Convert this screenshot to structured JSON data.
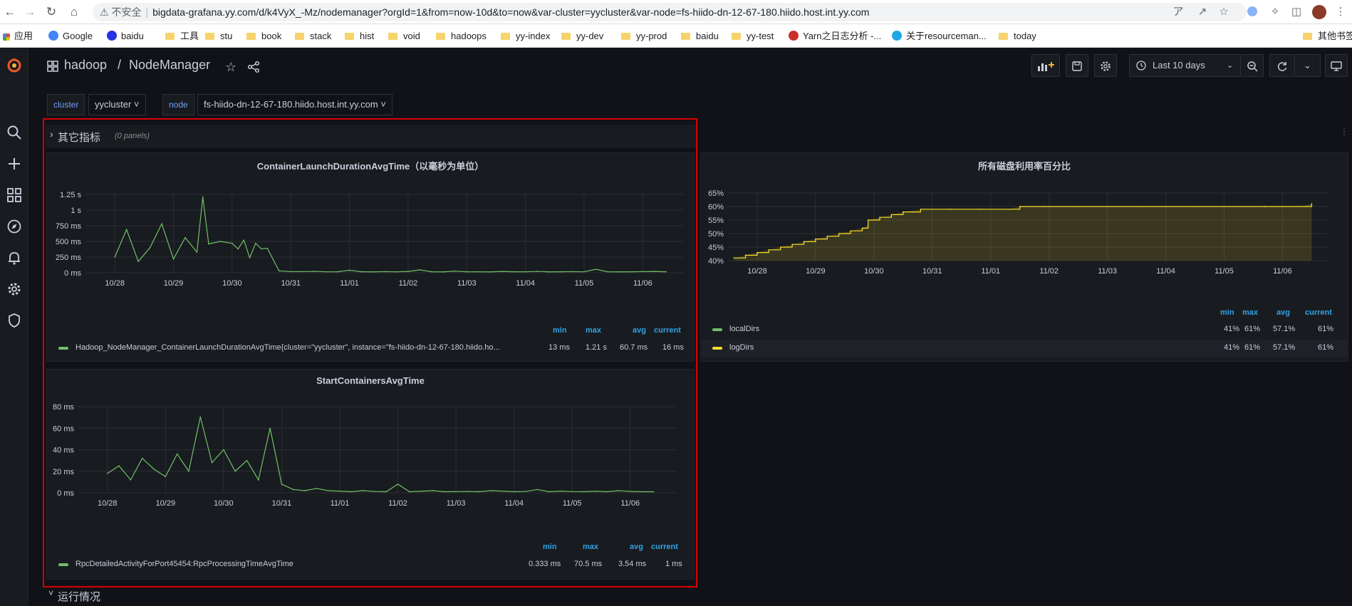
{
  "browser": {
    "insecure_label": "不安全",
    "url": "bigdata-grafana.yy.com/d/k4VyX_-Mz/nodemanager?orgId=1&from=now-10d&to=now&var-cluster=yycluster&var-node=fs-hiido-dn-12-67-180.hiido.host.int.yy.com",
    "bookmarks": [
      {
        "label": "应用",
        "kind": "apps"
      },
      {
        "label": "Google",
        "kind": "google"
      },
      {
        "label": "baidu",
        "kind": "baidu"
      },
      {
        "label": "工具",
        "kind": "folder"
      },
      {
        "label": "stu",
        "kind": "folder"
      },
      {
        "label": "book",
        "kind": "folder"
      },
      {
        "label": "stack",
        "kind": "folder"
      },
      {
        "label": "hist",
        "kind": "folder"
      },
      {
        "label": "void",
        "kind": "folder"
      },
      {
        "label": "hadoops",
        "kind": "folder"
      },
      {
        "label": "yy-index",
        "kind": "folder"
      },
      {
        "label": "yy-dev",
        "kind": "folder"
      },
      {
        "label": "yy-prod",
        "kind": "folder"
      },
      {
        "label": "baidu",
        "kind": "folder"
      },
      {
        "label": "yy-test",
        "kind": "folder"
      },
      {
        "label": "Yarn之日志分析 -...",
        "kind": "site-red"
      },
      {
        "label": "关于resourceman...",
        "kind": "site-blue"
      },
      {
        "label": "today",
        "kind": "folder"
      }
    ],
    "other_bookmarks": "其他书签"
  },
  "dashboard": {
    "folder": "hadoop",
    "separator": "/",
    "title": "NodeManager",
    "time_range": "Last 10 days",
    "variables": [
      {
        "label": "cluster",
        "value": "yycluster"
      },
      {
        "label": "node",
        "value": "fs-hiido-dn-12-67-180.hiido.host.int.yy.com"
      }
    ],
    "rows": [
      {
        "title": "其它指标",
        "subtitle": "(0 panels)"
      },
      {
        "title": "运行情况"
      }
    ]
  },
  "legend_headers": {
    "min": "min",
    "max": "max",
    "avg": "avg",
    "current": "current"
  },
  "colors": {
    "green": "#73bf69",
    "yellow": "#fade2a",
    "accent": "#33a2e5",
    "logo": "#f05a28"
  },
  "chart_data": [
    {
      "type": "line",
      "title": "ContainerLaunchDurationAvgTime（以毫秒为单位）",
      "x_ticks": [
        "10/28",
        "10/29",
        "10/30",
        "10/31",
        "11/01",
        "11/02",
        "11/03",
        "11/04",
        "11/05",
        "11/06"
      ],
      "y_ticks": [
        "1.25 s",
        "1 s",
        "750 ms",
        "500 ms",
        "250 ms",
        "0 ms"
      ],
      "ylim": [
        0,
        1250
      ],
      "unit": "ms",
      "series": [
        {
          "name": "Hadoop_NodeManager_ContainerLaunchDurationAvgTime{cluster=\"yycluster\", instance=\"fs-hiido-dn-12-67-180.hiido.ho...",
          "color": "#73bf69",
          "min": "13 ms",
          "max": "1.21 s",
          "avg": "60.7 ms",
          "current": "16 ms",
          "x": [
            0.0,
            0.2,
            0.4,
            0.6,
            0.8,
            1.0,
            1.2,
            1.4,
            1.5,
            1.6,
            1.8,
            2.0,
            2.1,
            2.2,
            2.3,
            2.4,
            2.5,
            2.6,
            2.7,
            2.8,
            3.0,
            3.2,
            3.4,
            3.6,
            3.8,
            4.0,
            4.2,
            4.4,
            4.6,
            4.8,
            5.0,
            5.2,
            5.4,
            5.6,
            5.8,
            6.0,
            6.2,
            6.4,
            6.6,
            6.8,
            7.0,
            7.2,
            7.4,
            7.6,
            7.8,
            8.0,
            8.2,
            8.4,
            8.6,
            8.8,
            9.0,
            9.2,
            9.4
          ],
          "values": [
            250,
            690,
            180,
            400,
            780,
            220,
            560,
            330,
            1210,
            460,
            500,
            470,
            380,
            520,
            240,
            470,
            380,
            390,
            210,
            30,
            18,
            18,
            22,
            15,
            16,
            40,
            16,
            14,
            18,
            15,
            20,
            45,
            16,
            14,
            25,
            16,
            15,
            14,
            20,
            16,
            15,
            22,
            14,
            16,
            18,
            15,
            55,
            16,
            14,
            15,
            18,
            20,
            16
          ]
        }
      ]
    },
    {
      "type": "line",
      "title": "StartContainersAvgTime",
      "x_ticks": [
        "10/28",
        "10/29",
        "10/30",
        "10/31",
        "11/01",
        "11/02",
        "11/03",
        "11/04",
        "11/05",
        "11/06"
      ],
      "y_ticks": [
        "80 ms",
        "60 ms",
        "40 ms",
        "20 ms",
        "0 ms"
      ],
      "ylim": [
        0,
        80
      ],
      "unit": "ms",
      "series": [
        {
          "name": "RpcDetailedActivityForPort45454:RpcProcessingTimeAvgTime",
          "color": "#73bf69",
          "min": "0.333 ms",
          "max": "70.5 ms",
          "avg": "3.54 ms",
          "current": "1 ms",
          "x": [
            0.0,
            0.2,
            0.4,
            0.6,
            0.8,
            1.0,
            1.2,
            1.4,
            1.6,
            1.8,
            2.0,
            2.2,
            2.4,
            2.6,
            2.8,
            3.0,
            3.2,
            3.4,
            3.6,
            3.8,
            4.0,
            4.2,
            4.4,
            4.6,
            4.8,
            5.0,
            5.2,
            5.4,
            5.6,
            5.8,
            6.0,
            6.2,
            6.4,
            6.6,
            6.8,
            7.0,
            7.2,
            7.4,
            7.6,
            7.8,
            8.0,
            8.2,
            8.4,
            8.6,
            8.8,
            9.0,
            9.2,
            9.4
          ],
          "values": [
            18,
            25,
            12,
            32,
            22,
            15,
            36,
            20,
            70.5,
            28,
            40,
            20,
            30,
            12,
            60,
            8,
            3,
            2,
            4,
            2,
            1.5,
            1,
            2,
            1.2,
            1,
            8,
            1,
            1.4,
            2,
            1,
            1.1,
            1.2,
            1,
            2,
            1.5,
            1,
            1.2,
            3,
            1,
            1.5,
            1.1,
            1,
            1.4,
            1,
            2,
            1.2,
            1,
            1
          ]
        }
      ]
    },
    {
      "type": "area",
      "title": "所有磁盘利用率百分比",
      "x_ticks": [
        "10/28",
        "10/29",
        "10/30",
        "10/31",
        "11/01",
        "11/02",
        "11/03",
        "11/04",
        "11/05",
        "11/06"
      ],
      "y_ticks": [
        "65%",
        "60%",
        "55%",
        "50%",
        "45%",
        "40%"
      ],
      "ylim": [
        40,
        65
      ],
      "unit": "%",
      "series": [
        {
          "name": "localDirs",
          "color": "#73bf69",
          "min": "41%",
          "max": "61%",
          "avg": "57.1%",
          "current": "61%"
        },
        {
          "name": "logDirs",
          "color": "#fade2a",
          "min": "41%",
          "max": "61%",
          "avg": "57.1%",
          "current": "61%",
          "x": [
            -0.4,
            -0.2,
            0.0,
            0.2,
            0.4,
            0.6,
            0.8,
            1.0,
            1.2,
            1.4,
            1.6,
            1.8,
            1.9,
            1.9,
            2.1,
            2.3,
            2.5,
            2.8,
            3.3,
            3.8,
            4.3,
            4.5,
            4.9,
            5.5,
            6.5,
            7.5,
            8.3,
            8.5,
            8.7,
            8.7,
            8.9,
            9.1,
            9.3,
            9.5
          ],
          "values": [
            41,
            42,
            43,
            44,
            45,
            46,
            47,
            48,
            49,
            50,
            51,
            52,
            53,
            55,
            56,
            57,
            58,
            59,
            59,
            59,
            59,
            60,
            60,
            60,
            60,
            60,
            60,
            60,
            60,
            60,
            60,
            60,
            60,
            61
          ]
        }
      ]
    }
  ]
}
